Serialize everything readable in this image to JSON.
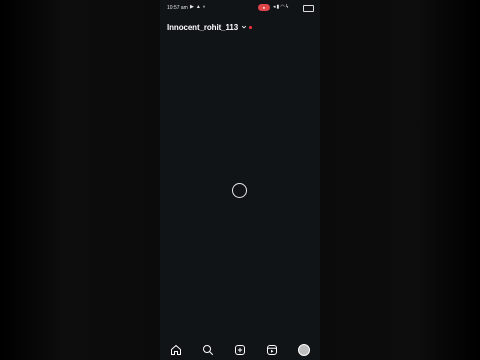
{
  "status_bar": {
    "time": "10:57 am",
    "record_label": "●"
  },
  "profile": {
    "username": "Innocent_rohit_113",
    "notification_dot_color": "#ff3040"
  },
  "loading": {
    "state": "loading"
  },
  "bottom_nav": {
    "items": [
      "home-icon",
      "search-icon",
      "create-icon",
      "reels-icon",
      "profile-avatar"
    ]
  }
}
